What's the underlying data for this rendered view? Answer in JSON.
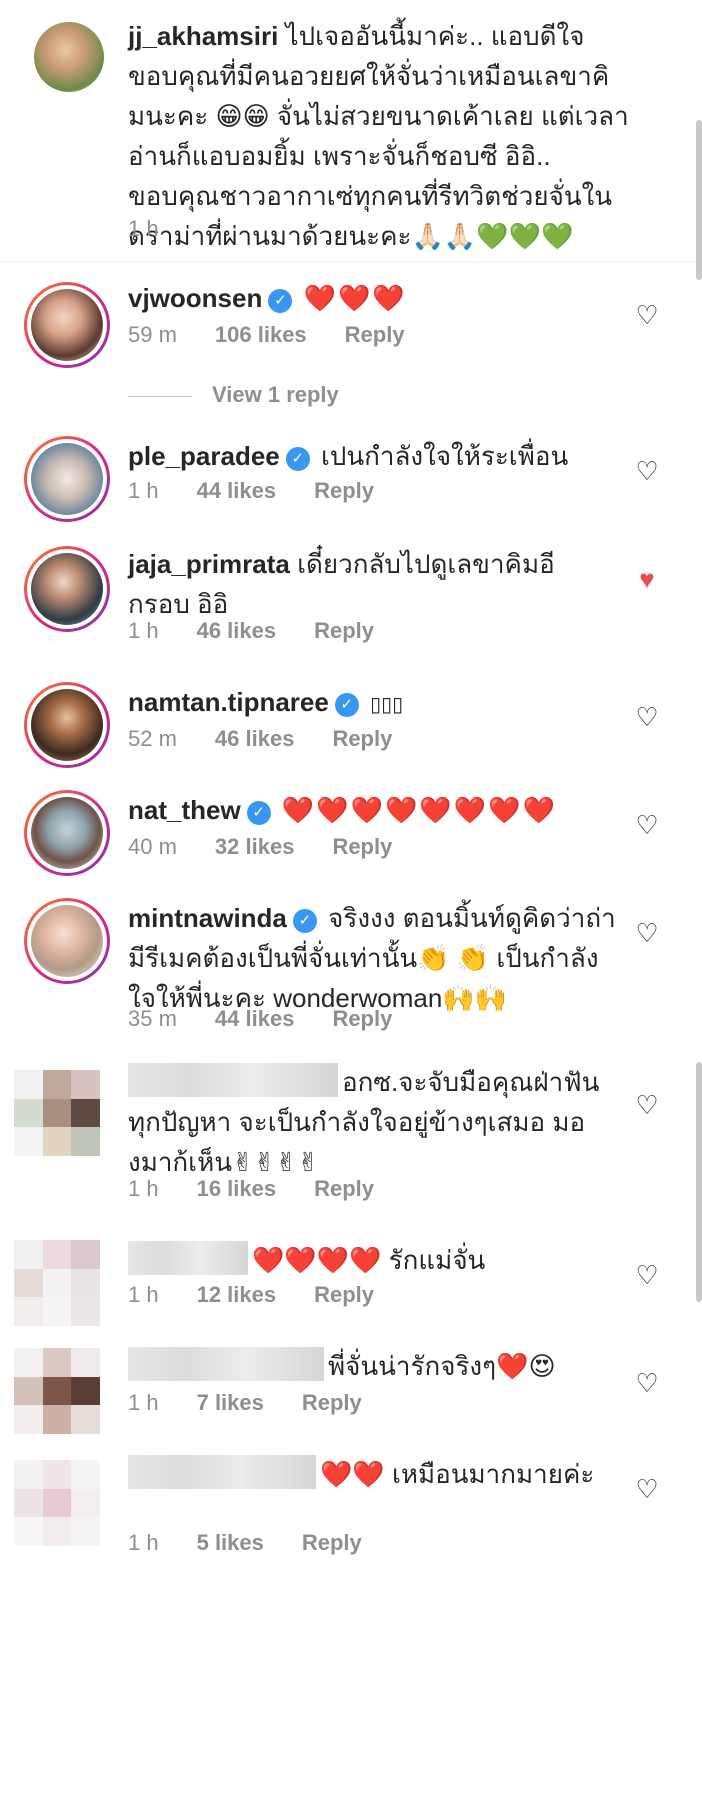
{
  "caption": {
    "username": "jj_akhamsiri",
    "text": "ไปเจออันนี้มาค่ะ.. แอบดีใจ ขอบคุณที่มีคนอวยยศให้จั่นว่าเหมือนเลขาคิมนะคะ 😁😁 จั่นไม่สวยขนาดเค้าเลย แต่เวลาอ่านก็แอบอมยิ้ม เพราะจั่นก็ชอบซี อิอิ.. ขอบคุณชาวอากาเซ่ทุกคนที่รีทวิตช่วยจั่นในดราม่าที่ผ่านมาด้วยนะคะ🙏🏻🙏🏻💚💚💚",
    "time": "1 h"
  },
  "comments": [
    {
      "username": "vjwoonsen",
      "verified": true,
      "text": "❤️❤️❤️",
      "time": "59 m",
      "likes": "106 likes",
      "reply": "Reply",
      "liked": false
    },
    {
      "username": "ple_paradee",
      "verified": true,
      "text": "เปนกำลังใจให้ระเพื่อน",
      "time": "1 h",
      "likes": "44 likes",
      "reply": "Reply",
      "liked": false
    },
    {
      "username": "jaja_primrata",
      "verified": false,
      "text": "เดี๋ยวกลับไปดูเลขาคิมอีกรอบ อิอิ",
      "time": "1 h",
      "likes": "46 likes",
      "reply": "Reply",
      "liked": true
    },
    {
      "username": "namtan.tipnaree",
      "verified": true,
      "text": "▯▯▯",
      "time": "52 m",
      "likes": "46 likes",
      "reply": "Reply",
      "liked": false
    },
    {
      "username": "nat_thew",
      "verified": true,
      "text": "❤️❤️❤️❤️❤️❤️❤️❤️",
      "time": "40 m",
      "likes": "32 likes",
      "reply": "Reply",
      "liked": false
    },
    {
      "username": "mintnawinda",
      "verified": true,
      "text": "จริงงง ตอนมิ้นท์ดูคิดว่าถ่ามีรีเมคต้องเป็นพี่จั่นเท่านั้น👏 👏 เป็นกำลังใจให้พี่นะคะ wonderwoman🙌🙌",
      "time": "35 m",
      "likes": "44 likes",
      "reply": "Reply",
      "liked": false
    },
    {
      "username": "",
      "verified": false,
      "text": "อกซ.จะจับมือคุณฝ่าฟันทุกปัญหา จะเป็นกำลังใจอยู่ข้างๆเสมอ มองมาก้เห็น✌✌✌✌",
      "time": "1 h",
      "likes": "16 likes",
      "reply": "Reply",
      "liked": false
    },
    {
      "username": "",
      "verified": false,
      "text": "❤️❤️❤️❤️ รักแม่จั่น",
      "time": "1 h",
      "likes": "12 likes",
      "reply": "Reply",
      "liked": false
    },
    {
      "username": "",
      "verified": false,
      "text": "พี่จั่นน่ารักจริงๆ❤️😍",
      "time": "1 h",
      "likes": "7 likes",
      "reply": "Reply",
      "liked": false
    },
    {
      "username": "",
      "verified": false,
      "text": "❤️❤️ เหมือนมากมายค่ะ",
      "time": "1 h",
      "likes": "5 likes",
      "reply": "Reply",
      "liked": false
    }
  ],
  "view_replies": "View 1 reply",
  "icons": {
    "heart": "heart-icon",
    "verified": "verified-badge-icon"
  },
  "colors": {
    "verified": "#3897f0",
    "liked_heart": "#ed4956",
    "meta": "#8e8e8e"
  }
}
